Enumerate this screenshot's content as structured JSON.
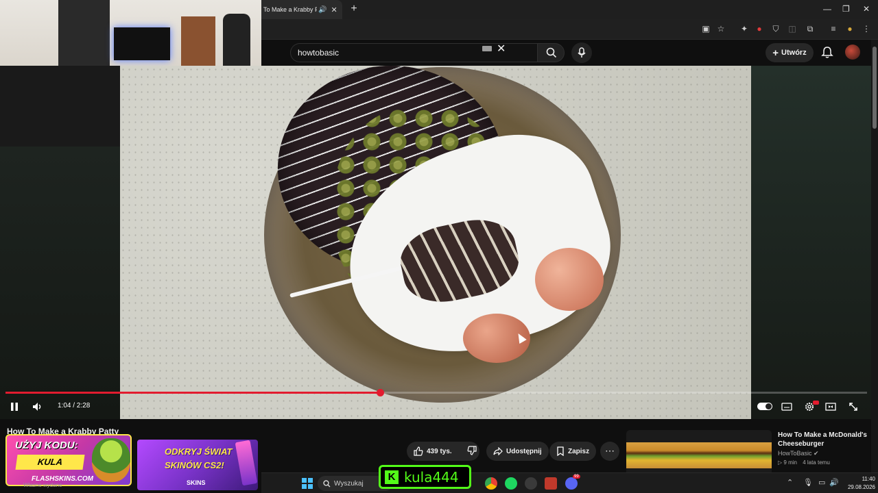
{
  "browser": {
    "tab_title": "To Make a Krabby Patty",
    "tab_speaker_icon": "speaker-icon",
    "new_tab_label": "+",
    "window_controls": {
      "minimize": "—",
      "maximize": "❐",
      "close": "✕"
    }
  },
  "youtube": {
    "search": {
      "value": "howtobasic"
    },
    "create_label": "Utwórz",
    "player": {
      "current_time": "1:04",
      "duration": "2:28",
      "time_display": "1:04 / 2:28",
      "progress_fraction": 0.435,
      "accent_color": "#e21c2f",
      "hd_badge": "HD"
    },
    "video": {
      "title": "How To Make a Krabby Patty",
      "likes": "439 tys.",
      "share_label": "Udostępnij",
      "save_label": "Zapisz",
      "more_label": "⋯"
    },
    "recommendation": {
      "title": "How To Make a McDonald's Cheeseburger",
      "channel": "HowToBasic",
      "duration": "9 min",
      "age": "4 lata temu"
    }
  },
  "overlays": {
    "ad_flashskins": {
      "code_line": "UŻYJ KODU:",
      "code": "KULA",
      "brand": "FLASHSKINS.COM"
    },
    "ad_skins": {
      "line1": "ODKRYJ ŚWIAT",
      "line2": "SKINÓW CS2!",
      "brand": "SKINS"
    },
    "kick": {
      "logo": "K",
      "name": "kula444",
      "color": "#53fc18"
    },
    "under_ad_text": "Własne wydane"
  },
  "taskbar": {
    "search_placeholder": "Wyszukaj",
    "time": "11:40",
    "date": "29.08.2026",
    "discord_badge": "99"
  }
}
